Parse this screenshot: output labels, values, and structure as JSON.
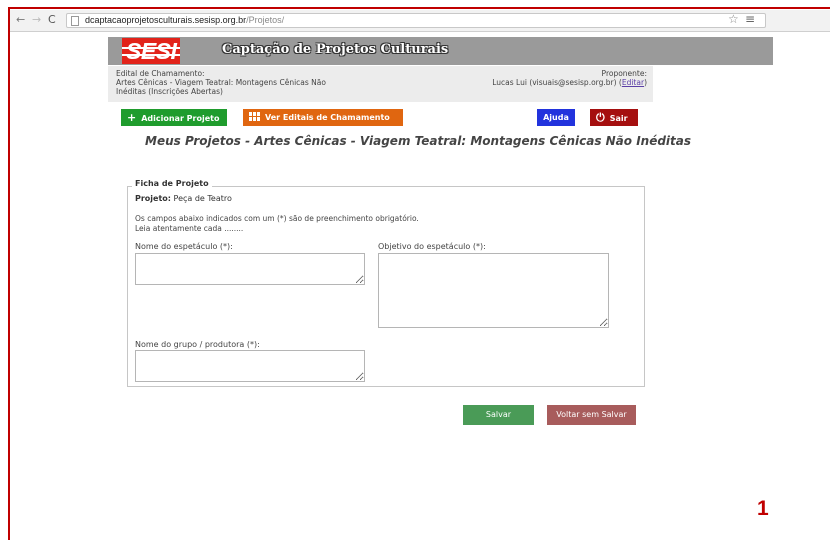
{
  "browser": {
    "url_host": "dcaptacaoprojetosculturais.sesisp.org.br",
    "url_path": "/Projetos/"
  },
  "header": {
    "logo": "SESI",
    "title": "Captação de Projetos Culturais"
  },
  "info": {
    "edital_label": "Edital de Chamamento:",
    "edital_line1": "Artes Cênicas - Viagem Teatral: Montagens Cênicas Não",
    "edital_line2": "Inéditas (Inscrições Abertas)",
    "proponente_label": "Proponente:",
    "proponente_user": "Lucas Lui (visuais@sesisp.org.br)",
    "edit_link": "Editar"
  },
  "actions": {
    "add_project": "Adicionar Projeto",
    "view_editais": "Ver Editais de Chamamento",
    "help": "Ajuda",
    "exit": "Sair"
  },
  "page_heading": "Meus Projetos - Artes Cênicas - Viagem Teatral: Montagens Cênicas Não Inéditas",
  "form": {
    "legend": "Ficha de Projeto",
    "project_label": "Projeto:",
    "project_value": "Peça de Teatro",
    "note_line1": "Os campos abaixo indicados com um (*) são de preenchimento obrigatório.",
    "note_line2": "Leia atentamente cada ........",
    "fields": {
      "nome_espetaculo": {
        "label": "Nome do espetáculo (*):",
        "value": ""
      },
      "objetivo_espetaculo": {
        "label": "Objetivo do espetáculo (*):",
        "value": ""
      },
      "nome_grupo": {
        "label": "Nome do grupo / produtora (*):",
        "value": ""
      }
    },
    "save_label": "Salvar",
    "back_label": "Voltar sem Salvar"
  },
  "page_number": "1",
  "colors": {
    "frame": "#c00000",
    "add_button": "#1f9c2d",
    "editais_button": "#e06610",
    "help_button": "#2233dd",
    "exit_button": "#a50f0f",
    "save_button": "#4a9b57",
    "back_button": "#a85c5c"
  },
  "icons": {
    "add": "plus-icon",
    "editais": "grid-icon",
    "exit": "power-icon"
  }
}
